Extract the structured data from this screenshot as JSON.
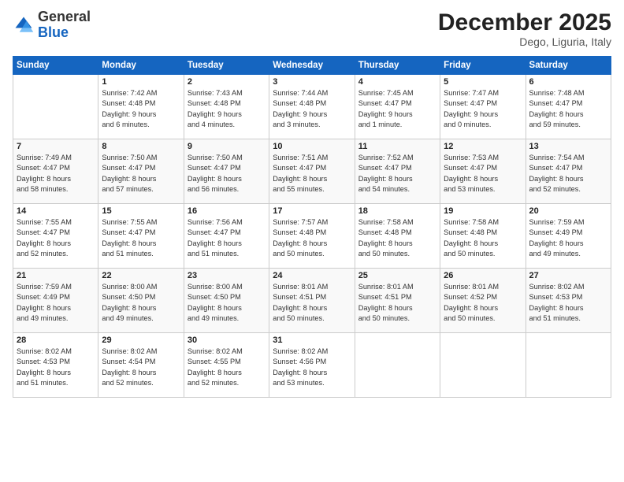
{
  "header": {
    "logo_general": "General",
    "logo_blue": "Blue",
    "month_title": "December 2025",
    "location": "Dego, Liguria, Italy"
  },
  "days_of_week": [
    "Sunday",
    "Monday",
    "Tuesday",
    "Wednesday",
    "Thursday",
    "Friday",
    "Saturday"
  ],
  "weeks": [
    [
      {
        "day": "",
        "info": ""
      },
      {
        "day": "1",
        "info": "Sunrise: 7:42 AM\nSunset: 4:48 PM\nDaylight: 9 hours\nand 6 minutes."
      },
      {
        "day": "2",
        "info": "Sunrise: 7:43 AM\nSunset: 4:48 PM\nDaylight: 9 hours\nand 4 minutes."
      },
      {
        "day": "3",
        "info": "Sunrise: 7:44 AM\nSunset: 4:48 PM\nDaylight: 9 hours\nand 3 minutes."
      },
      {
        "day": "4",
        "info": "Sunrise: 7:45 AM\nSunset: 4:47 PM\nDaylight: 9 hours\nand 1 minute."
      },
      {
        "day": "5",
        "info": "Sunrise: 7:47 AM\nSunset: 4:47 PM\nDaylight: 9 hours\nand 0 minutes."
      },
      {
        "day": "6",
        "info": "Sunrise: 7:48 AM\nSunset: 4:47 PM\nDaylight: 8 hours\nand 59 minutes."
      }
    ],
    [
      {
        "day": "7",
        "info": "Sunrise: 7:49 AM\nSunset: 4:47 PM\nDaylight: 8 hours\nand 58 minutes."
      },
      {
        "day": "8",
        "info": "Sunrise: 7:50 AM\nSunset: 4:47 PM\nDaylight: 8 hours\nand 57 minutes."
      },
      {
        "day": "9",
        "info": "Sunrise: 7:50 AM\nSunset: 4:47 PM\nDaylight: 8 hours\nand 56 minutes."
      },
      {
        "day": "10",
        "info": "Sunrise: 7:51 AM\nSunset: 4:47 PM\nDaylight: 8 hours\nand 55 minutes."
      },
      {
        "day": "11",
        "info": "Sunrise: 7:52 AM\nSunset: 4:47 PM\nDaylight: 8 hours\nand 54 minutes."
      },
      {
        "day": "12",
        "info": "Sunrise: 7:53 AM\nSunset: 4:47 PM\nDaylight: 8 hours\nand 53 minutes."
      },
      {
        "day": "13",
        "info": "Sunrise: 7:54 AM\nSunset: 4:47 PM\nDaylight: 8 hours\nand 52 minutes."
      }
    ],
    [
      {
        "day": "14",
        "info": "Sunrise: 7:55 AM\nSunset: 4:47 PM\nDaylight: 8 hours\nand 52 minutes."
      },
      {
        "day": "15",
        "info": "Sunrise: 7:55 AM\nSunset: 4:47 PM\nDaylight: 8 hours\nand 51 minutes."
      },
      {
        "day": "16",
        "info": "Sunrise: 7:56 AM\nSunset: 4:47 PM\nDaylight: 8 hours\nand 51 minutes."
      },
      {
        "day": "17",
        "info": "Sunrise: 7:57 AM\nSunset: 4:48 PM\nDaylight: 8 hours\nand 50 minutes."
      },
      {
        "day": "18",
        "info": "Sunrise: 7:58 AM\nSunset: 4:48 PM\nDaylight: 8 hours\nand 50 minutes."
      },
      {
        "day": "19",
        "info": "Sunrise: 7:58 AM\nSunset: 4:48 PM\nDaylight: 8 hours\nand 50 minutes."
      },
      {
        "day": "20",
        "info": "Sunrise: 7:59 AM\nSunset: 4:49 PM\nDaylight: 8 hours\nand 49 minutes."
      }
    ],
    [
      {
        "day": "21",
        "info": "Sunrise: 7:59 AM\nSunset: 4:49 PM\nDaylight: 8 hours\nand 49 minutes."
      },
      {
        "day": "22",
        "info": "Sunrise: 8:00 AM\nSunset: 4:50 PM\nDaylight: 8 hours\nand 49 minutes."
      },
      {
        "day": "23",
        "info": "Sunrise: 8:00 AM\nSunset: 4:50 PM\nDaylight: 8 hours\nand 49 minutes."
      },
      {
        "day": "24",
        "info": "Sunrise: 8:01 AM\nSunset: 4:51 PM\nDaylight: 8 hours\nand 50 minutes."
      },
      {
        "day": "25",
        "info": "Sunrise: 8:01 AM\nSunset: 4:51 PM\nDaylight: 8 hours\nand 50 minutes."
      },
      {
        "day": "26",
        "info": "Sunrise: 8:01 AM\nSunset: 4:52 PM\nDaylight: 8 hours\nand 50 minutes."
      },
      {
        "day": "27",
        "info": "Sunrise: 8:02 AM\nSunset: 4:53 PM\nDaylight: 8 hours\nand 51 minutes."
      }
    ],
    [
      {
        "day": "28",
        "info": "Sunrise: 8:02 AM\nSunset: 4:53 PM\nDaylight: 8 hours\nand 51 minutes."
      },
      {
        "day": "29",
        "info": "Sunrise: 8:02 AM\nSunset: 4:54 PM\nDaylight: 8 hours\nand 52 minutes."
      },
      {
        "day": "30",
        "info": "Sunrise: 8:02 AM\nSunset: 4:55 PM\nDaylight: 8 hours\nand 52 minutes."
      },
      {
        "day": "31",
        "info": "Sunrise: 8:02 AM\nSunset: 4:56 PM\nDaylight: 8 hours\nand 53 minutes."
      },
      {
        "day": "",
        "info": ""
      },
      {
        "day": "",
        "info": ""
      },
      {
        "day": "",
        "info": ""
      }
    ]
  ]
}
